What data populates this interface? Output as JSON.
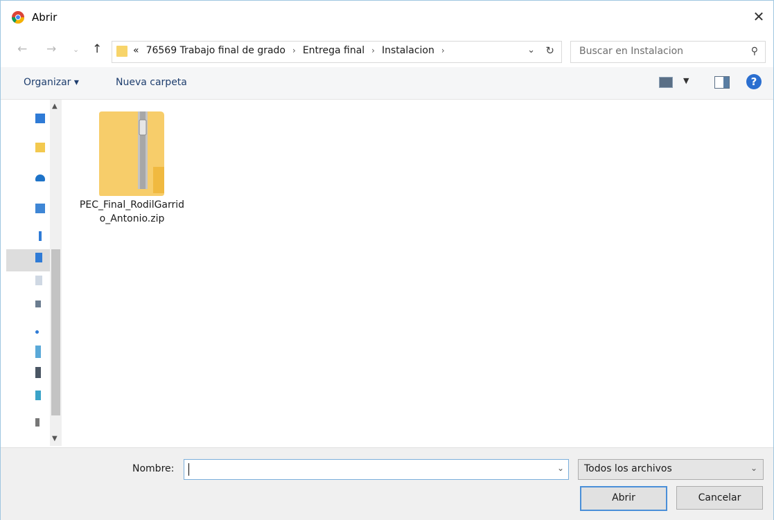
{
  "window": {
    "title": "Abrir"
  },
  "address": {
    "prefix": "«",
    "crumbs": [
      "76569 Trabajo final de grado",
      "Entrega final",
      "Instalacion"
    ],
    "separator": "›"
  },
  "search": {
    "placeholder": "Buscar en Instalacion"
  },
  "toolbar": {
    "organize": "Organizar ▾",
    "new_folder": "Nueva carpeta",
    "help": "?"
  },
  "files": [
    {
      "name": "PEC_Final_RodilGarrido_Antonio.zip",
      "type": "zip-folder-icon"
    }
  ],
  "bottom": {
    "name_label": "Nombre:",
    "name_value": "",
    "filter": "Todos los archivos",
    "open": "Abrir",
    "cancel": "Cancelar"
  },
  "icons": {
    "app": "chrome-icon",
    "close": "close-icon",
    "back": "back-arrow-icon",
    "forward": "forward-arrow-icon",
    "recent": "chevron-down-icon",
    "up": "up-arrow-icon",
    "refresh": "refresh-icon",
    "search": "search-icon"
  }
}
